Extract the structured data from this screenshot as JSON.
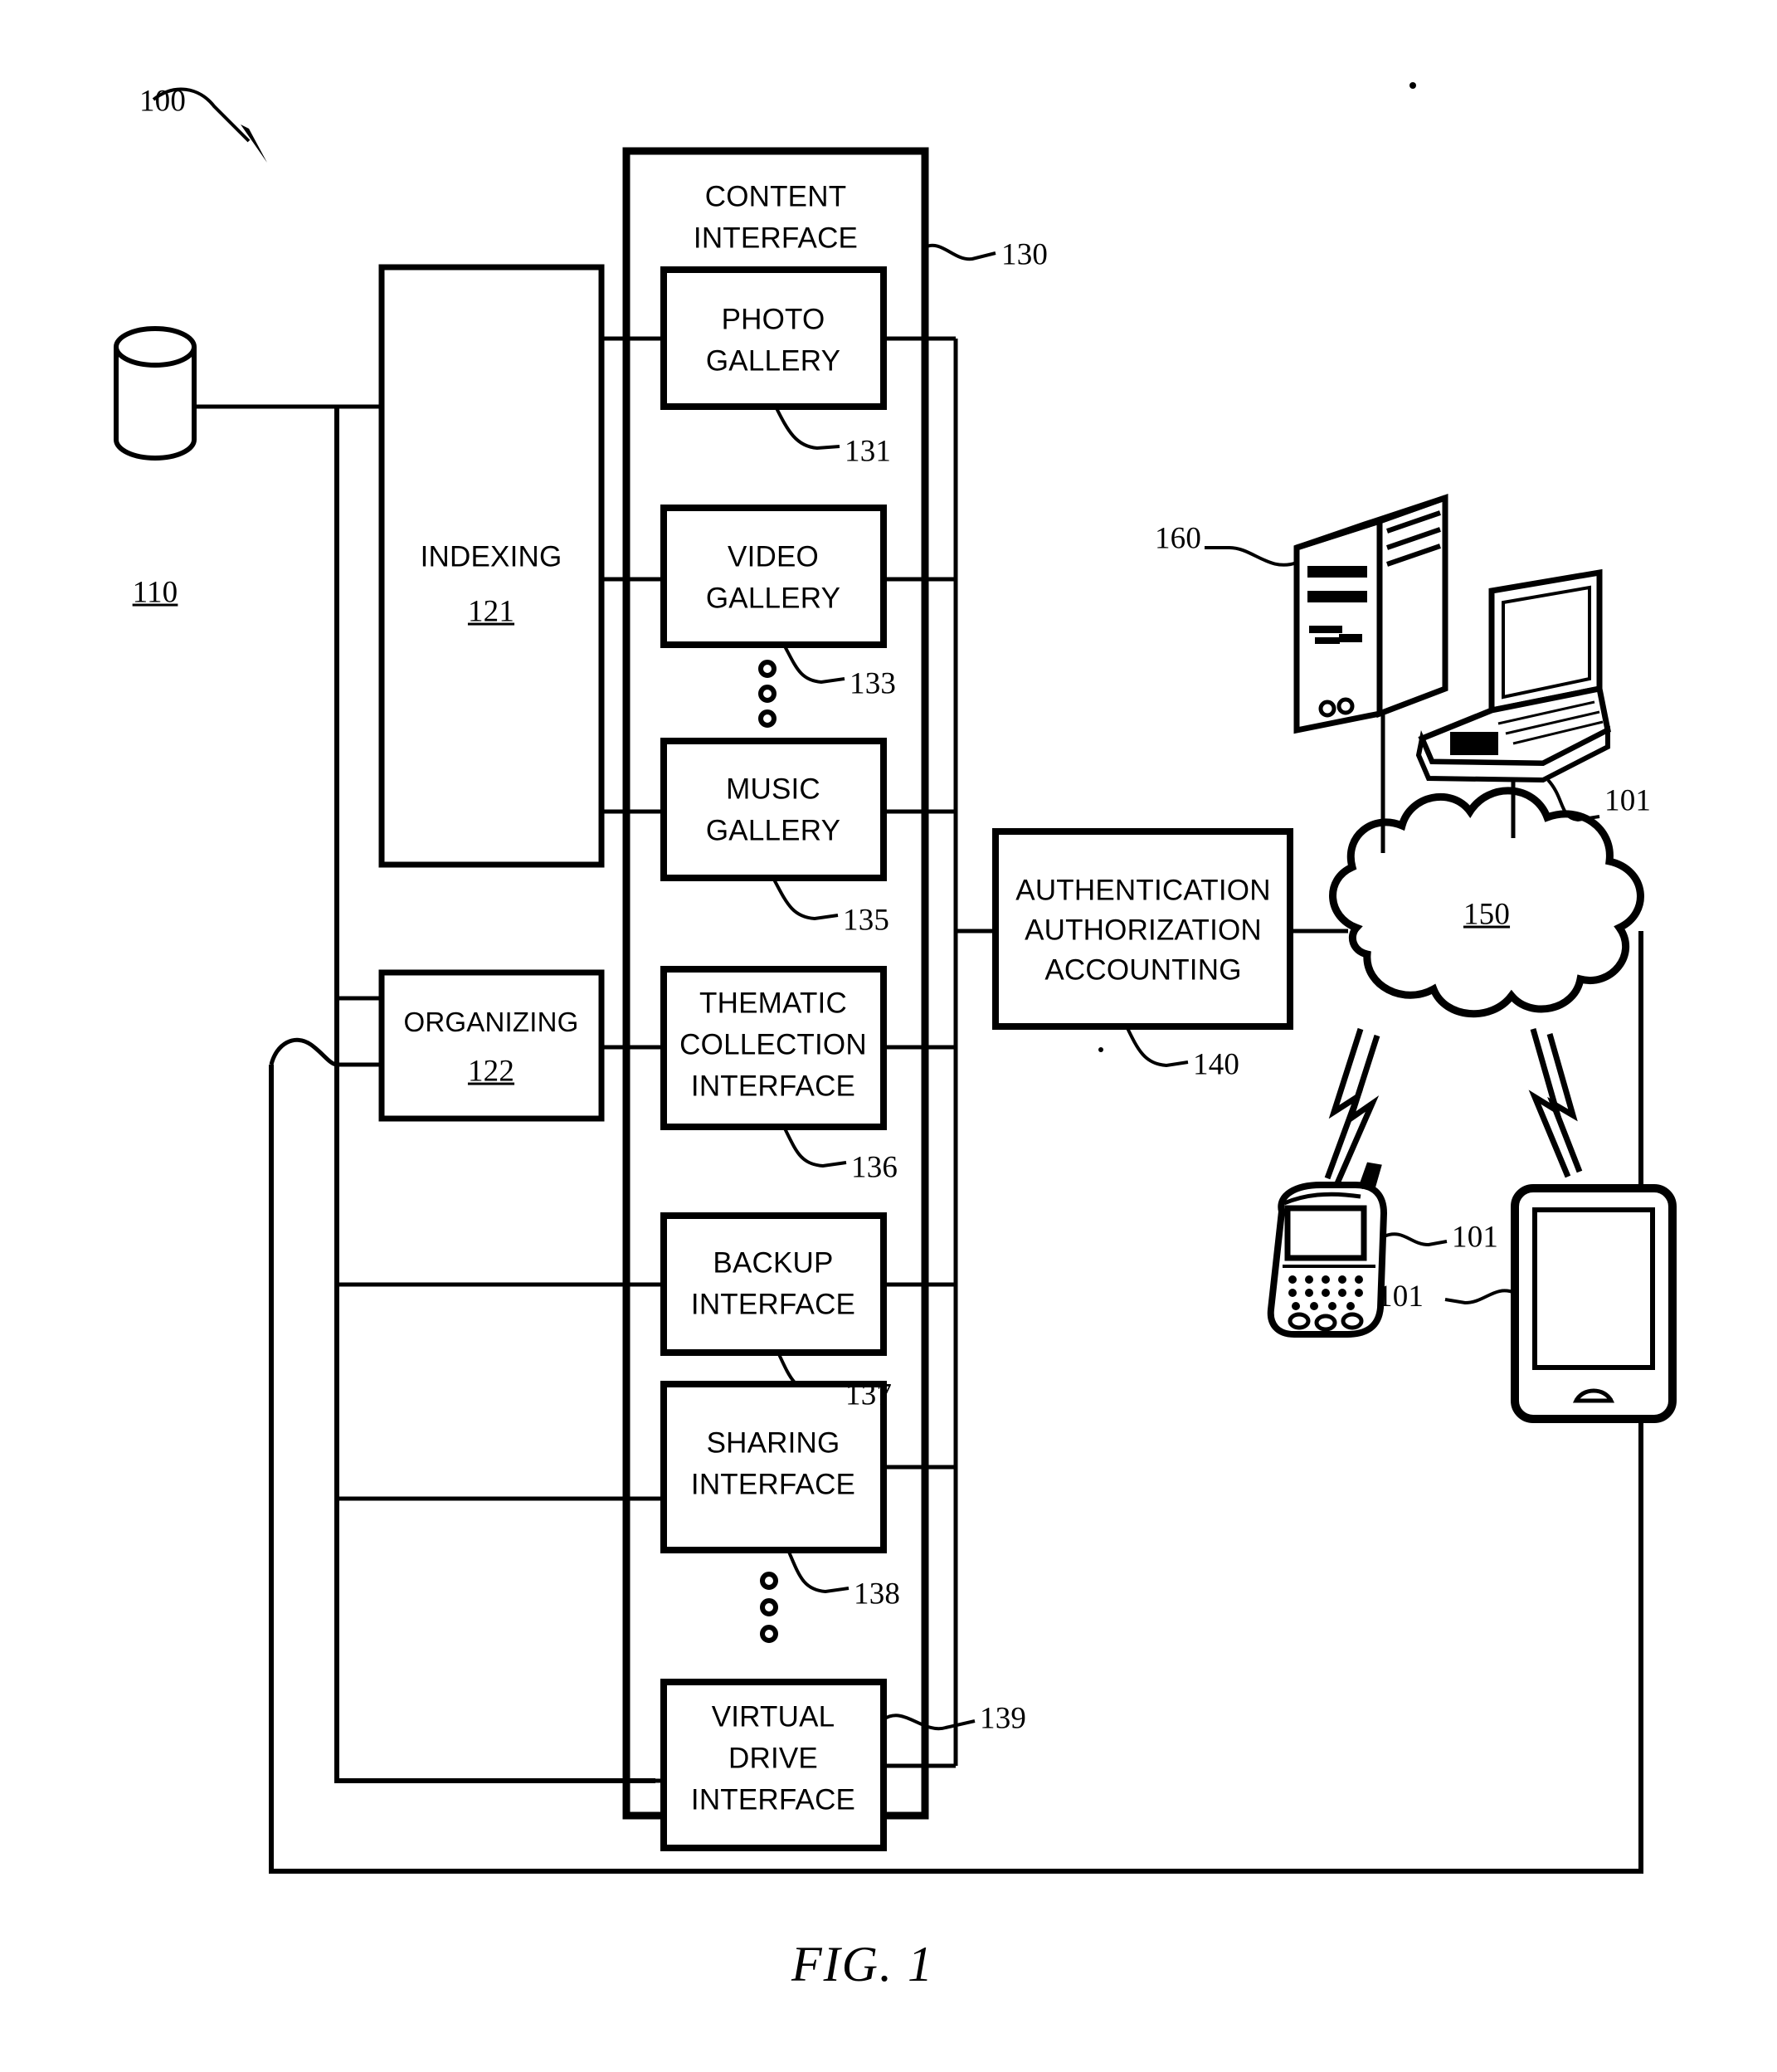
{
  "figure": {
    "caption": "FIG. 1",
    "system_ref": "100"
  },
  "storage": {
    "name": "database-cylinder",
    "ref": "110"
  },
  "modules": [
    {
      "name": "indexing",
      "label": "INDEXING",
      "ref": "121"
    },
    {
      "name": "organizing",
      "label": "ORGANIZING",
      "ref": "122"
    }
  ],
  "content_interface": {
    "title_line1": "CONTENT",
    "title_line2": "INTERFACE",
    "ref": "130",
    "items": [
      {
        "name": "photo-gallery",
        "lines": [
          "PHOTO",
          "GALLERY"
        ],
        "ref": "131"
      },
      {
        "name": "video-gallery",
        "lines": [
          "VIDEO",
          "GALLERY"
        ],
        "ref": "133"
      },
      {
        "name": "music-gallery",
        "lines": [
          "MUSIC",
          "GALLERY"
        ],
        "ref": "135"
      },
      {
        "name": "thematic-collection-interface",
        "lines": [
          "THEMATIC",
          "COLLECTION",
          "INTERFACE"
        ],
        "ref": "136"
      },
      {
        "name": "backup-interface",
        "lines": [
          "BACKUP",
          "INTERFACE"
        ],
        "ref": "137"
      },
      {
        "name": "sharing-interface",
        "lines": [
          "SHARING",
          "INTERFACE"
        ],
        "ref": "138"
      },
      {
        "name": "virtual-drive-interface",
        "lines": [
          "VIRTUAL",
          "DRIVE",
          "INTERFACE"
        ],
        "ref": "139"
      }
    ]
  },
  "aaa": {
    "line1": "AUTHENTICATION",
    "line2": "AUTHORIZATION",
    "line3": "ACCOUNTING",
    "ref": "140"
  },
  "network": {
    "name": "cloud",
    "ref": "150"
  },
  "devices": [
    {
      "name": "server-tower",
      "ref": "160"
    },
    {
      "name": "laptop",
      "ref": "101"
    },
    {
      "name": "mobile-phone",
      "ref": "101"
    },
    {
      "name": "tablet",
      "ref": "101"
    }
  ],
  "ellipses": [
    {
      "name": "ellipsis-between-video-and-music"
    },
    {
      "name": "ellipsis-between-sharing-and-virtual-drive"
    }
  ],
  "colors": {
    "ink": "#000000",
    "paper": "#ffffff"
  }
}
